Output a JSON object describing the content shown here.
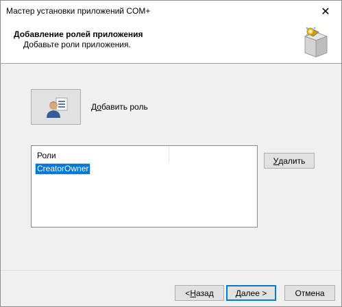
{
  "window": {
    "title": "Мастер установки приложений COM+",
    "close_glyph": "✕"
  },
  "header": {
    "title": "Добавление ролей приложения",
    "subtitle": "Добавьте роли приложения.",
    "icon": "box-install-icon"
  },
  "add_role": {
    "icon": "user-role-icon",
    "label_pre": "Д",
    "label_accel": "о",
    "label_post": "бавить роль"
  },
  "roles_list": {
    "columns": [
      "Роли",
      ""
    ],
    "items": [
      "CreatorOwner"
    ],
    "selected_index": 0
  },
  "delete_button": {
    "accel": "У",
    "rest": "далить"
  },
  "footer": {
    "back": {
      "pre": "< ",
      "accel": "Н",
      "post": "азад"
    },
    "next": {
      "pre": "",
      "accel": "Д",
      "post": "алее >"
    },
    "cancel": "Отмена"
  },
  "colors": {
    "selection": "#0078d7",
    "button_face": "#e1e1e1",
    "dialog_bg": "#f0f0f0"
  }
}
